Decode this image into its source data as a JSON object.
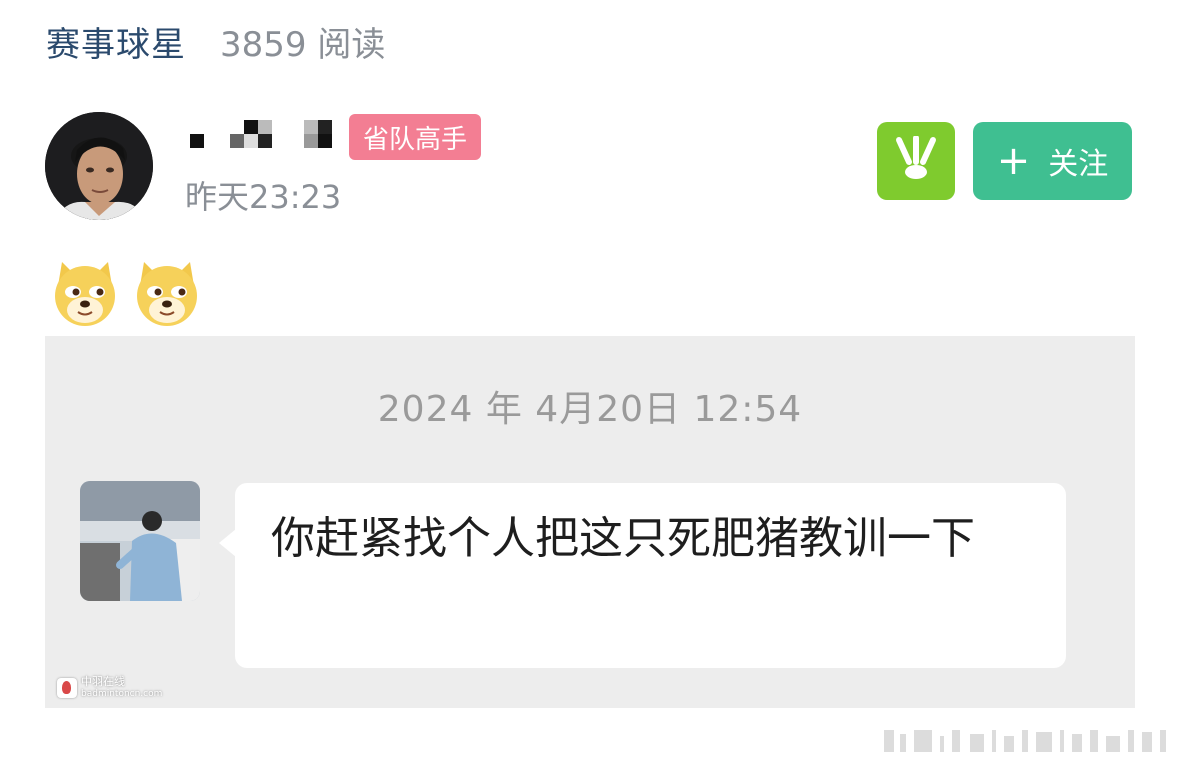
{
  "header": {
    "channel": "赛事球星",
    "reads": "3859 阅读"
  },
  "post": {
    "badge": "省队高手",
    "time": "昨天23:23",
    "emojis": [
      "doge",
      "doge"
    ],
    "follow_label": "关注"
  },
  "screenshot": {
    "date": "2024 年 4月20日 12:54",
    "message": "你赶紧找个人把这只死肥猪教训一下",
    "watermark_line1": "中羽在线",
    "watermark_line2": "badmintoncn.com"
  },
  "colors": {
    "channel": "#2b4a6d",
    "badge": "#f37e93",
    "app_button": "#7fcb2e",
    "follow_button": "#3fbf91",
    "screenshot_bg": "#ededed"
  },
  "icons": {
    "follow": "plus-icon",
    "app": "shuttlecock-icon"
  }
}
